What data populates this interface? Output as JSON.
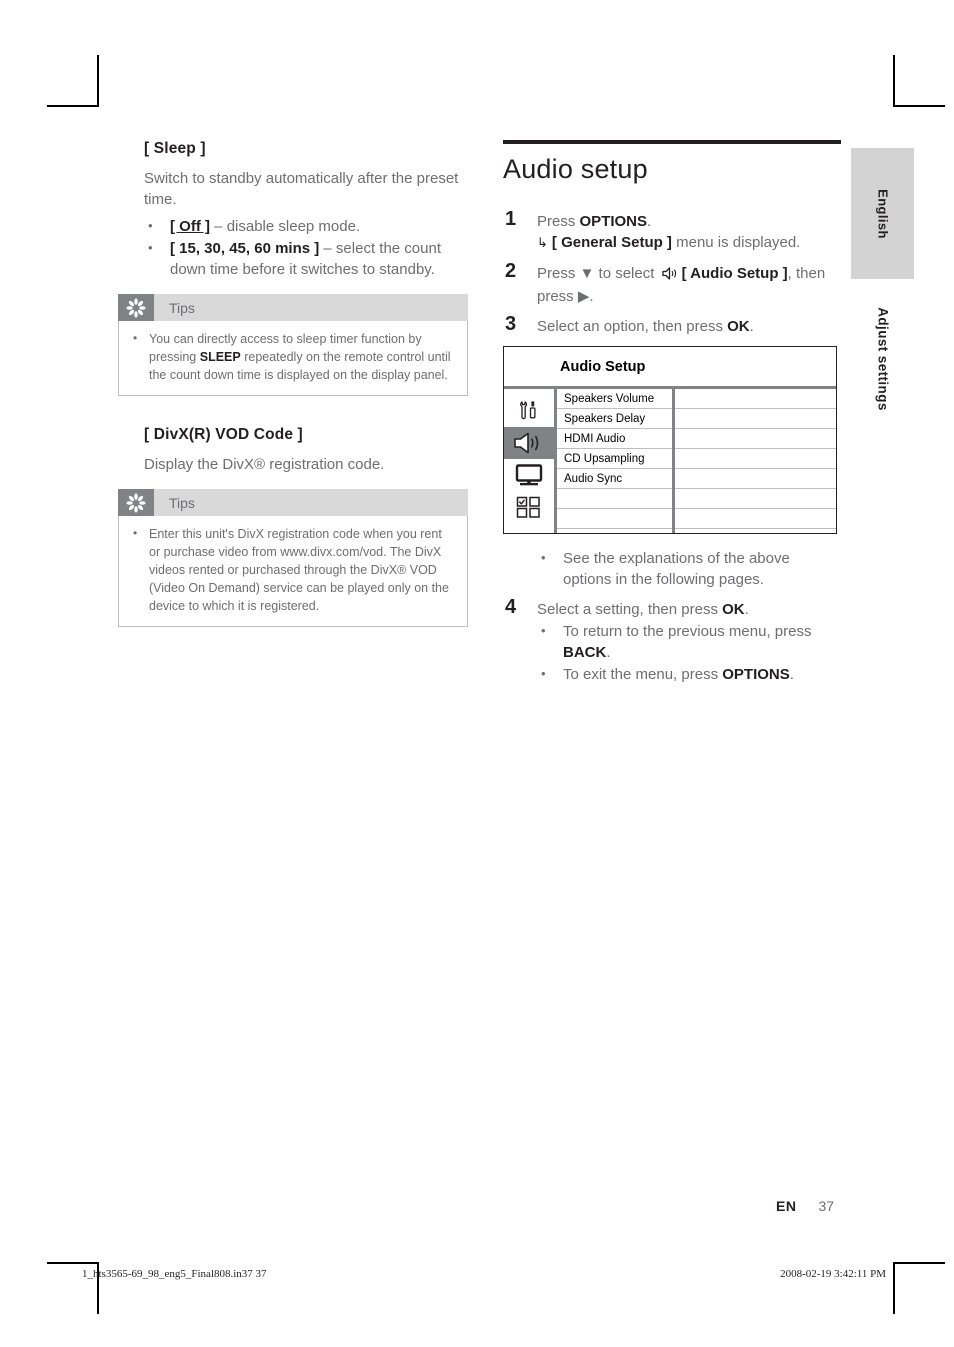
{
  "side_tabs": {
    "language": "English",
    "section": "Adjust settings"
  },
  "left_column": {
    "sleep": {
      "heading": "[ Sleep ]",
      "description": "Switch to standby automatically after the preset time.",
      "options": [
        {
          "term": "[ Off ]",
          "rest": " – disable sleep mode."
        },
        {
          "term": "[ 15, 30, 45, 60 mins ]",
          "rest": " – select the count down time before it switches to standby."
        }
      ],
      "tips": {
        "label": "Tips",
        "items": [
          {
            "pre": "You can directly access to sleep timer function by pressing ",
            "bold": "SLEEP",
            "post": " repeatedly on the remote control until the count down time is displayed on the display panel."
          }
        ]
      }
    },
    "divx": {
      "heading": "[ DivX(R) VOD Code ]",
      "description": "Display the DivX® registration code.",
      "tips": {
        "label": "Tips",
        "items": [
          {
            "pre": "Enter this unit's DivX registration code when you rent or purchase video from www.divx.com/vod. The DivX videos rented or purchased through the DivX® VOD (Video On Demand) service can be played only on the device to which it is registered.",
            "bold": "",
            "post": ""
          }
        ]
      }
    }
  },
  "right_column": {
    "title": "Audio setup",
    "steps": [
      {
        "num": "1",
        "pre": "Press ",
        "bold": "OPTIONS",
        "post": ".",
        "result_arrow": "↳",
        "result_bold": "[ General Setup ]",
        "result_post": " menu is displayed."
      },
      {
        "num": "2",
        "pre": "Press ▼ to select ",
        "icon": "speaker-icon",
        "bold": "[ Audio Setup ]",
        "post": ", then press ▶."
      },
      {
        "num": "3",
        "pre": "Select an option, then press ",
        "bold": "OK",
        "post": "."
      },
      {
        "num": "4",
        "pre": "Select a setting, then press ",
        "bold": "OK",
        "post": ".",
        "bullets": [
          {
            "pre": "To return to the previous menu, press ",
            "bold": "BACK",
            "post": "."
          },
          {
            "pre": "To exit the menu, press ",
            "bold": "OPTIONS",
            "post": "."
          }
        ]
      }
    ],
    "figure_note": "See the explanations of the above options in the following pages.",
    "osd": {
      "title": "Audio Setup",
      "icons": [
        {
          "name": "tools-icon",
          "selected": false
        },
        {
          "name": "speaker-icon",
          "selected": true
        },
        {
          "name": "tv-icon",
          "selected": false
        },
        {
          "name": "preferences-grid-icon",
          "selected": false
        }
      ],
      "rows": [
        {
          "label": "Speakers Volume",
          "value": ""
        },
        {
          "label": "Speakers Delay",
          "value": ""
        },
        {
          "label": "HDMI Audio",
          "value": ""
        },
        {
          "label": "CD Upsampling",
          "value": ""
        },
        {
          "label": "Audio Sync",
          "value": ""
        },
        {
          "label": "",
          "value": ""
        },
        {
          "label": "",
          "value": ""
        },
        {
          "label": "",
          "value": ""
        }
      ]
    }
  },
  "footer": {
    "lang_code": "EN",
    "page_number": "37",
    "file_stamp": "1_hts3565-69_98_eng5_Final808.in37   37",
    "time_stamp": "2008-02-19   3:42:11 PM"
  }
}
